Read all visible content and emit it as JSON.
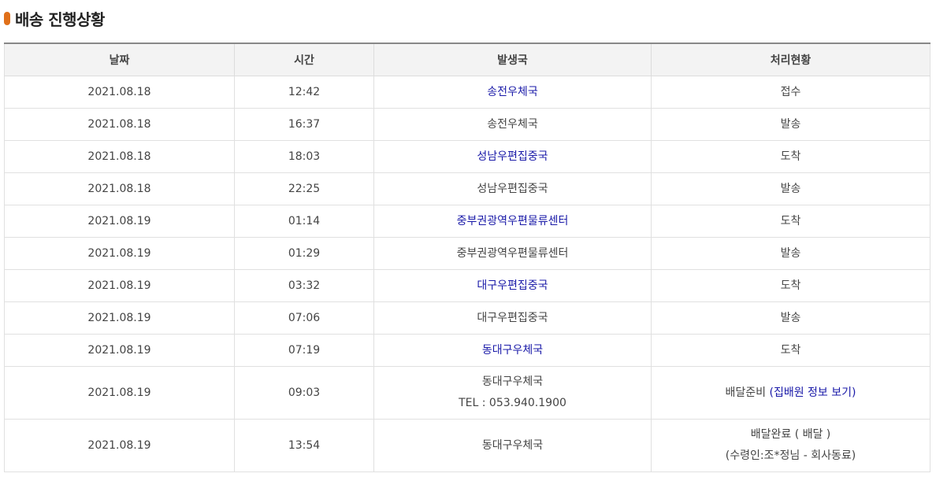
{
  "section": {
    "title": "배송 진행상황"
  },
  "table": {
    "headers": [
      "날짜",
      "시간",
      "발생국",
      "처리현황"
    ],
    "rows": [
      {
        "date": "2021.08.18",
        "time": "12:42",
        "office": "송전우체국",
        "status": "접수"
      },
      {
        "date": "2021.08.18",
        "time": "16:37",
        "office": "송전우체국",
        "status": "발송"
      },
      {
        "date": "2021.08.18",
        "time": "18:03",
        "office": "성남우편집중국",
        "status": "도착"
      },
      {
        "date": "2021.08.18",
        "time": "22:25",
        "office": "성남우편집중국",
        "status": "발송"
      },
      {
        "date": "2021.08.19",
        "time": "01:14",
        "office": "중부권광역우편물류센터",
        "status": "도착"
      },
      {
        "date": "2021.08.19",
        "time": "01:29",
        "office": "중부권광역우편물류센터",
        "status": "발송"
      },
      {
        "date": "2021.08.19",
        "time": "03:32",
        "office": "대구우편집중국",
        "status": "도착"
      },
      {
        "date": "2021.08.19",
        "time": "07:06",
        "office": "대구우편집중국",
        "status": "발송"
      },
      {
        "date": "2021.08.19",
        "time": "07:19",
        "office": "동대구우체국",
        "status": "도착"
      },
      {
        "date": "2021.08.19",
        "time": "09:03",
        "office": "동대구우체국",
        "office_tel": "TEL : 053.940.1900",
        "status": "배달준비",
        "status_link_open": "(",
        "status_link": "집배원 정보 보기",
        "status_link_close": ")"
      },
      {
        "date": "2021.08.19",
        "time": "13:54",
        "office": "동대구우체국",
        "status": "배달완료 ( 배달 )",
        "status_note": "(수령인:조*정님 - 회사동료)"
      }
    ]
  }
}
